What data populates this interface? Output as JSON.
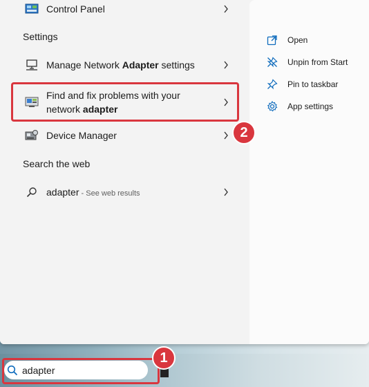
{
  "apps": {
    "control_panel": {
      "label": "Control Panel"
    },
    "manage_network": {
      "label_before": "Manage Network ",
      "label_bold": "Adapter",
      "label_after": " settings"
    },
    "find_fix": {
      "line1": "Find and fix problems with your",
      "line2_before": "network ",
      "line2_bold": "adapter"
    },
    "device_manager": {
      "label": "Device Manager"
    }
  },
  "sections": {
    "settings": "Settings",
    "search_web": "Search the web"
  },
  "web_result": {
    "query": "adapter",
    "suffix": " - See web results"
  },
  "actions": [
    {
      "label": "Open",
      "icon": "open-icon"
    },
    {
      "label": "Unpin from Start",
      "icon": "unpin-icon"
    },
    {
      "label": "Pin to taskbar",
      "icon": "pin-icon"
    },
    {
      "label": "App settings",
      "icon": "gear-icon"
    }
  ],
  "taskbar": {
    "search_value": "adapter"
  },
  "annotations": {
    "step1": "1",
    "step2": "2"
  },
  "colors": {
    "highlight": "#d9363e",
    "panel_bg": "#f3f3f3",
    "accent_icon": "#0f6cbd"
  }
}
